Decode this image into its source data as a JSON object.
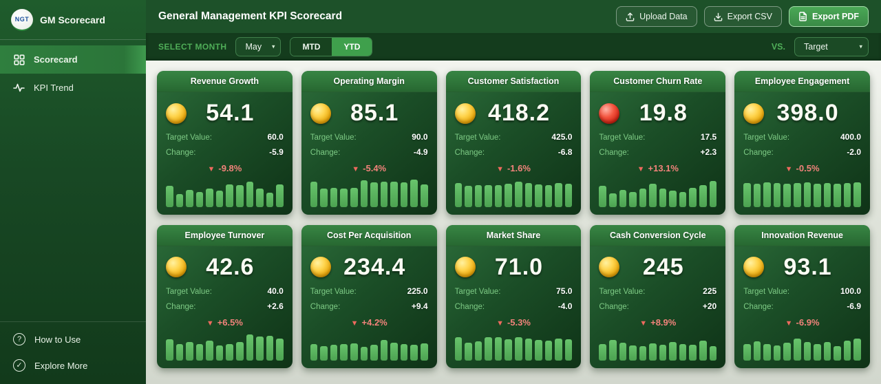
{
  "app": {
    "logo_text": "NGT",
    "brand": "GM Scorecard"
  },
  "sidebar": {
    "nav": [
      {
        "label": "Scorecard"
      },
      {
        "label": "KPI Trend"
      }
    ],
    "footer": [
      {
        "label": "How to Use"
      },
      {
        "label": "Explore More"
      }
    ]
  },
  "header": {
    "title": "General Management KPI Scorecard",
    "upload_label": "Upload Data",
    "export_csv_label": "Export CSV",
    "export_pdf_label": "Export PDF"
  },
  "filterbar": {
    "select_month_label": "SELECT MONTH",
    "month_value": "May",
    "mtd_label": "MTD",
    "ytd_label": "YTD",
    "vs_label": "VS.",
    "vs_value": "Target"
  },
  "labels": {
    "target": "Target Value:",
    "change": "Change:"
  },
  "colors": {
    "accent_green": "#3fa04c",
    "status_ok": "#f2c21a",
    "status_alert": "#e23b2e",
    "delta_red": "#f2837b",
    "bar_green": "#55b259",
    "card_green_dark": "#16431f"
  },
  "cards": [
    {
      "title": "Revenue Growth",
      "status": "yellow",
      "value": "54.1",
      "target": "60.0",
      "change": "-5.9",
      "delta_arrow": "▼",
      "delta": "-9.8%",
      "spark": [
        72,
        45,
        58,
        52,
        62,
        55,
        78,
        74,
        88,
        62,
        50,
        78
      ]
    },
    {
      "title": "Operating Margin",
      "status": "yellow",
      "value": "85.1",
      "target": "90.0",
      "change": "-4.9",
      "delta_arrow": "▼",
      "delta": "-5.4%",
      "spark": [
        88,
        62,
        66,
        62,
        66,
        92,
        84,
        88,
        86,
        84,
        95,
        78
      ]
    },
    {
      "title": "Customer Satisfaction",
      "status": "yellow",
      "value": "418.2",
      "target": "425.0",
      "change": "-6.8",
      "delta_arrow": "▼",
      "delta": "-1.6%",
      "spark": [
        82,
        72,
        76,
        74,
        76,
        80,
        88,
        82,
        78,
        76,
        82,
        80
      ]
    },
    {
      "title": "Customer Churn Rate",
      "status": "red",
      "value": "19.8",
      "target": "17.5",
      "change": "+2.3",
      "delta_arrow": "▼",
      "delta": "+13.1%",
      "spark": [
        72,
        46,
        58,
        52,
        62,
        80,
        64,
        56,
        52,
        66,
        74,
        90
      ]
    },
    {
      "title": "Employee Engagement",
      "status": "yellow",
      "value": "398.0",
      "target": "400.0",
      "change": "-2.0",
      "delta_arrow": "▼",
      "delta": "-0.5%",
      "spark": [
        82,
        80,
        84,
        82,
        80,
        82,
        84,
        80,
        82,
        80,
        82,
        84
      ]
    },
    {
      "title": "Employee Turnover",
      "status": "yellow",
      "value": "42.6",
      "target": "40.0",
      "change": "+2.6",
      "delta_arrow": "▼",
      "delta": "+6.5%",
      "spark": [
        74,
        58,
        64,
        56,
        70,
        52,
        56,
        64,
        90,
        84,
        86,
        76
      ]
    },
    {
      "title": "Cost Per Acquisition",
      "status": "yellow",
      "value": "234.4",
      "target": "225.0",
      "change": "+9.4",
      "delta_arrow": "▼",
      "delta": "+4.2%",
      "spark": [
        56,
        50,
        54,
        58,
        60,
        48,
        54,
        72,
        62,
        58,
        54,
        60
      ]
    },
    {
      "title": "Market Share",
      "status": "yellow",
      "value": "71.0",
      "target": "75.0",
      "change": "-4.0",
      "delta_arrow": "▼",
      "delta": "-5.3%",
      "spark": [
        80,
        62,
        66,
        82,
        80,
        74,
        80,
        76,
        72,
        70,
        76,
        74
      ]
    },
    {
      "title": "Cash Conversion Cycle",
      "status": "yellow",
      "value": "245",
      "target": "225",
      "change": "+20",
      "delta_arrow": "▼",
      "delta": "+8.9%",
      "spark": [
        56,
        72,
        62,
        52,
        50,
        60,
        54,
        64,
        58,
        54,
        68,
        50
      ]
    },
    {
      "title": "Innovation Revenue",
      "status": "yellow",
      "value": "93.1",
      "target": "100.0",
      "change": "-6.9",
      "delta_arrow": "▼",
      "delta": "-6.9%",
      "spark": [
        56,
        66,
        58,
        52,
        62,
        76,
        64,
        58,
        64,
        50,
        70,
        76
      ]
    }
  ]
}
